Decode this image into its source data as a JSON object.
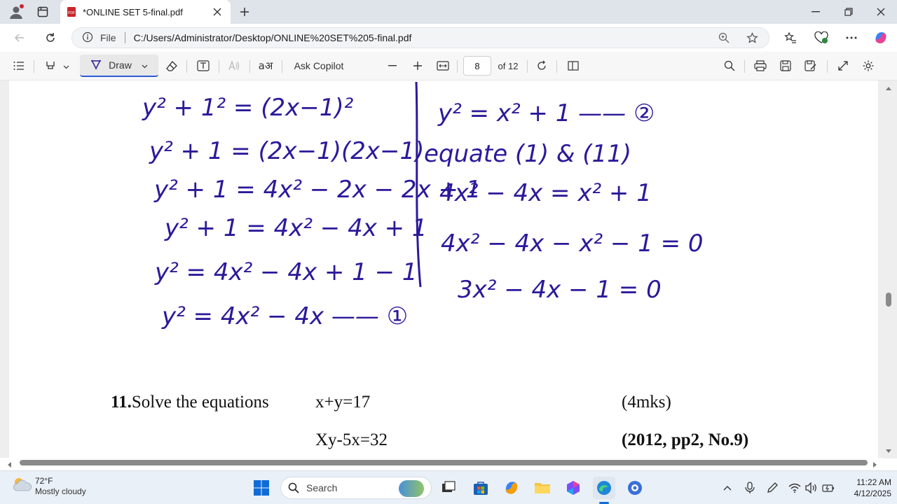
{
  "browser": {
    "tab_title": "*ONLINE SET 5-final.pdf",
    "file_label": "File",
    "url": "C:/Users/Administrator/Desktop/ONLINE%20SET%205-final.pdf"
  },
  "pdf_toolbar": {
    "draw_label": "Draw",
    "ask_copilot": "Ask Copilot",
    "page_number": "8",
    "page_total": "of 12"
  },
  "handwriting": {
    "left": [
      "y² + 1² = (2x−1)²",
      "y² + 1 = (2x−1)(2x−1)",
      "y² + 1 = 4x² − 2x − 2x + 1",
      "y² + 1 = 4x² − 4x + 1",
      "y² = 4x² − 4x + 1 − 1",
      "y² = 4x² − 4x —— ①"
    ],
    "right": [
      "y² = x² + 1 —— ②",
      "equate (1) & (11)",
      "4x² − 4x = x² + 1",
      "4x² − 4x − x² − 1 = 0",
      "3x² − 4x − 1 = 0"
    ],
    "ink_color": "#2a1a9a"
  },
  "question": {
    "number": "11.",
    "text": "Solve the equations",
    "eq1": "x+y=17",
    "eq2": "Xy-5x=32",
    "marks": "(4mks)",
    "source": "(2012, pp2, No.9)"
  },
  "taskbar": {
    "weather_temp": "72°F",
    "weather_desc": "Mostly cloudy",
    "search_label": "Search",
    "time": "11:22 AM",
    "date": "4/12/2025"
  }
}
